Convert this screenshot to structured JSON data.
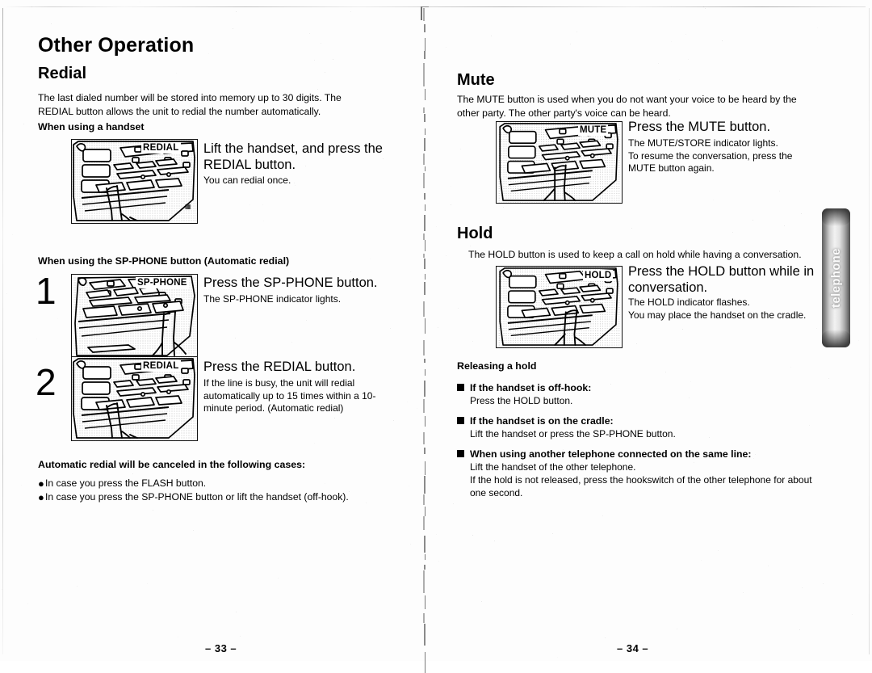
{
  "document": {
    "title": "Other Operation",
    "kind": "telephone user manual spread"
  },
  "side_tab": {
    "label": "telephone"
  },
  "left_page": {
    "page_number": "– 33 –",
    "heading": "Other Operation",
    "section": {
      "title": "Redial",
      "intro": "The last dialed number will be stored into memory up to 30 digits. The REDIAL button allows the unit to redial the number automatically.",
      "sub1": {
        "title": "When using a handset",
        "illustration_label": "REDIAL",
        "instruction": "Lift the handset, and press the REDIAL button.",
        "note": "You can redial once."
      },
      "sub2": {
        "title": "When using the SP-PHONE button (Automatic redial)",
        "steps": [
          {
            "number": "1",
            "illustration_label": "SP-PHONE",
            "instruction": "Press the SP-PHONE button.",
            "note": "The SP-PHONE indicator lights."
          },
          {
            "number": "2",
            "illustration_label": "REDIAL",
            "instruction": "Press the REDIAL button.",
            "note": "If the line is busy, the unit will redial automatically up to 15 times within a 10-minute period. (Automatic redial)"
          }
        ]
      },
      "cancel": {
        "title": "Automatic redial will be canceled in the following cases:",
        "bullets": [
          "In case you press the FLASH button.",
          "In case you press the SP-PHONE button or lift the handset (off-hook)."
        ]
      }
    }
  },
  "right_page": {
    "page_number": "– 34 –",
    "sections": [
      {
        "title": "Mute",
        "intro": "The MUTE button is used when you do not want your voice to be heard by the other party. The other party's voice can be heard.",
        "illustration_label": "MUTE",
        "instruction": "Press the MUTE button.",
        "note": "The MUTE/STORE indicator lights.\nTo resume the conversation, press the\nMUTE button again."
      },
      {
        "title": "Hold",
        "intro": "The HOLD button is used to keep a call on hold while having a conversation.",
        "illustration_label": "HOLD",
        "instruction": "Press the HOLD button while in conversation.",
        "note": "The HOLD indicator flashes.\nYou may place the handset on the cradle."
      }
    ],
    "releasing": {
      "title": "Releasing a hold",
      "items": [
        {
          "head": "If the handset is off-hook:",
          "body": "Press the HOLD button."
        },
        {
          "head": "If the handset is on the cradle:",
          "body": "Lift the handset or press the SP-PHONE button."
        },
        {
          "head": "When using another telephone connected on the same line:",
          "body": "Lift the handset of the other telephone.\nIf the hold is not released, press the hookswitch of the other telephone for about one second."
        }
      ]
    }
  },
  "colors": {
    "ink": "#000000",
    "paper": "#fdfdfd",
    "tab_text": "#fbfbfb"
  }
}
